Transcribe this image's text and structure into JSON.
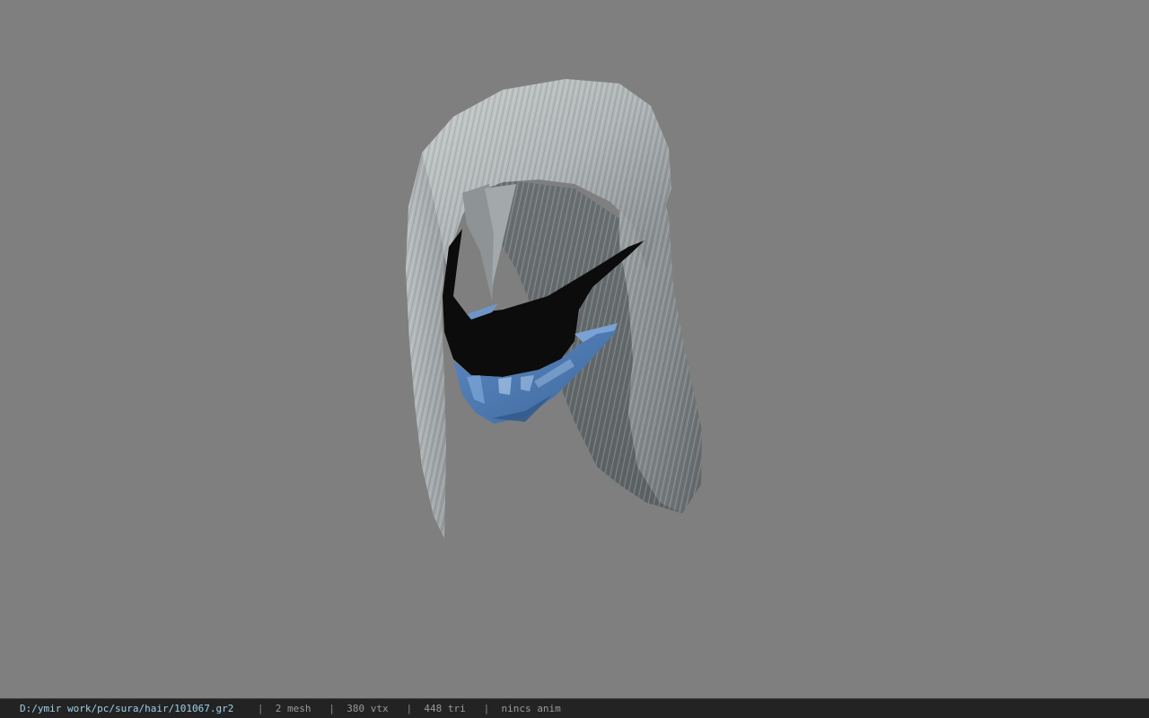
{
  "viewer": {
    "background_color": "#7f7f7f",
    "model_description_icon": "hair-mesh-preview"
  },
  "status": {
    "path": "D:/ymir work/pc/sura/hair/101067.gr2",
    "separator": "|",
    "mesh": "2 mesh",
    "vtx": "380 vtx",
    "tri": "448 tri",
    "anim": "nincs anim"
  }
}
